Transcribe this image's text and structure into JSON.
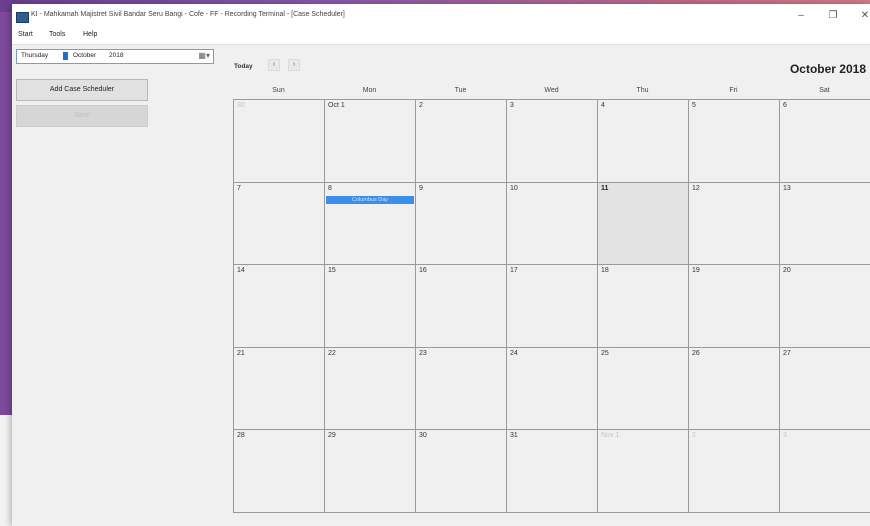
{
  "window": {
    "title": "KI - Mahkamah Majistret Sivil Bandar Seru Bangi - Cofe - FF - Recording Terminal - [Case Scheduler]",
    "controls": {
      "minimize": "–",
      "maximize": "❐",
      "close": "✕"
    }
  },
  "menu": {
    "items": [
      "Start",
      "Tools",
      "Help"
    ]
  },
  "datepicker": {
    "weekday": "Thursday",
    "month": "October",
    "year": "2018"
  },
  "left_panel": {
    "add_button": "Add Case Scheduler",
    "disabled_button": "Save"
  },
  "calendar": {
    "today_label": "Today",
    "prev_icon": "‹",
    "next_icon": "›",
    "month_title": "October 2018",
    "weekdays": [
      "Sun",
      "Mon",
      "Tue",
      "Wed",
      "Thu",
      "Fri",
      "Sat"
    ],
    "today_index": 11,
    "days": [
      {
        "label": "30",
        "other": true
      },
      {
        "label": "Oct 1",
        "other": false
      },
      {
        "label": "2",
        "other": false
      },
      {
        "label": "3",
        "other": false
      },
      {
        "label": "4",
        "other": false
      },
      {
        "label": "5",
        "other": false
      },
      {
        "label": "6",
        "other": false
      },
      {
        "label": "7",
        "other": false
      },
      {
        "label": "8",
        "other": false,
        "event": "Columbus Day"
      },
      {
        "label": "9",
        "other": false
      },
      {
        "label": "10",
        "other": false
      },
      {
        "label": "11",
        "other": false
      },
      {
        "label": "12",
        "other": false
      },
      {
        "label": "13",
        "other": false
      },
      {
        "label": "14",
        "other": false
      },
      {
        "label": "15",
        "other": false
      },
      {
        "label": "16",
        "other": false
      },
      {
        "label": "17",
        "other": false
      },
      {
        "label": "18",
        "other": false
      },
      {
        "label": "19",
        "other": false
      },
      {
        "label": "20",
        "other": false
      },
      {
        "label": "21",
        "other": false
      },
      {
        "label": "22",
        "other": false
      },
      {
        "label": "23",
        "other": false
      },
      {
        "label": "24",
        "other": false
      },
      {
        "label": "25",
        "other": false
      },
      {
        "label": "26",
        "other": false
      },
      {
        "label": "27",
        "other": false
      },
      {
        "label": "28",
        "other": false
      },
      {
        "label": "29",
        "other": false
      },
      {
        "label": "30",
        "other": false
      },
      {
        "label": "31",
        "other": false
      },
      {
        "label": "Nov 1",
        "other": true
      },
      {
        "label": "2",
        "other": true
      },
      {
        "label": "3",
        "other": true
      }
    ]
  }
}
